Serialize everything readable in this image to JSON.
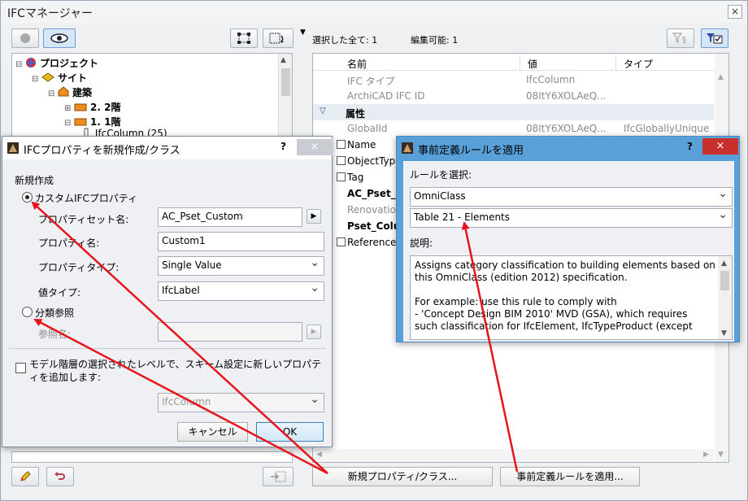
{
  "main": {
    "title": "IFCマネージャー",
    "close": "×",
    "info": {
      "selected": "選択した全て: 1",
      "editable": "編集可能: 1"
    },
    "tree": [
      {
        "label": "プロジェクト",
        "bold": true
      },
      {
        "label": "サイト",
        "bold": true
      },
      {
        "label": "建築",
        "bold": true
      },
      {
        "label": "2. 2階",
        "bold": true
      },
      {
        "label": "1. 1階",
        "bold": true
      },
      {
        "label": "IfcColumn (25)",
        "bold": false
      }
    ],
    "columns": {
      "name": "名前",
      "value": "値",
      "type": "タイプ"
    },
    "rows": [
      {
        "name": "IFC タイプ",
        "value": "IfcColumn",
        "type": "",
        "style": "gray"
      },
      {
        "name": "ArchiCAD IFC ID",
        "value": "08ItY6XOLAeQ...",
        "type": "",
        "style": "gray"
      },
      {
        "name": "属性",
        "value": "",
        "type": "",
        "style": "section"
      },
      {
        "name": "GlobalId",
        "value": "08ItY6XOLAeQ...",
        "type": "IfcGloballyUnique",
        "style": "gray"
      },
      {
        "name": "Name",
        "value": "",
        "type": "",
        "style": "normal"
      },
      {
        "name": "ObjectTyp",
        "value": "",
        "type": "",
        "style": "normal"
      },
      {
        "name": "Tag",
        "value": "",
        "type": "",
        "style": "normal"
      },
      {
        "name": "AC_Pset_",
        "value": "",
        "type": "",
        "style": "bold"
      },
      {
        "name": "Renovatio",
        "value": "",
        "type": "",
        "style": "gray"
      },
      {
        "name": "Pset_Colu",
        "value": "",
        "type": "",
        "style": "bold"
      },
      {
        "name": "Reference",
        "value": "",
        "type": "",
        "style": "normal"
      }
    ],
    "new_prop_button": "新規プロパティ/クラス...",
    "apply_rule_button": "事前定義ルールを適用..."
  },
  "dialog_new": {
    "title": "IFCプロパティを新規作成/クラス",
    "help": "?",
    "close": "×",
    "section": "新規作成",
    "custom_radio": "カスタムIFCプロパティ",
    "pset_label": "プロパティセット名:",
    "pset_value": "AC_Pset_Custom",
    "prop_label": "プロパティ名:",
    "prop_value": "Custom1",
    "ptype_label": "プロパティタイプ:",
    "ptype_value": "Single Value",
    "vtype_label": "値タイプ:",
    "vtype_value": "IfcLabel",
    "class_radio": "分類参照",
    "ref_label": "参照名:",
    "checkbox_line1": "モデル階層の選択されたレベルで、スキーム設定に新しいプロパテ",
    "checkbox_line2": "ィを追加します:",
    "scheme_value": "IfcColumn",
    "cancel": "キャンセル",
    "ok": "OK"
  },
  "dialog_rule": {
    "title": "事前定義ルールを適用",
    "help": "?",
    "close": "×",
    "select_label": "ルールを選択:",
    "select1": "OmniClass",
    "select2": "Table 21 - Elements",
    "desc_label": "説明:",
    "desc_lines": [
      "Assigns category classification to building elements based on",
      "this OmniClass (edition 2012) specification.",
      "",
      "For example: use this rule to comply with",
      "- 'Concept Design BIM 2010' MVD (GSA), which requires",
      "such classification for IfcElement, IfcTypeProduct (except"
    ]
  },
  "colors": {
    "arrow": "#e8141b",
    "accent": "#5aa0d8",
    "close_red": "#c9302c"
  }
}
